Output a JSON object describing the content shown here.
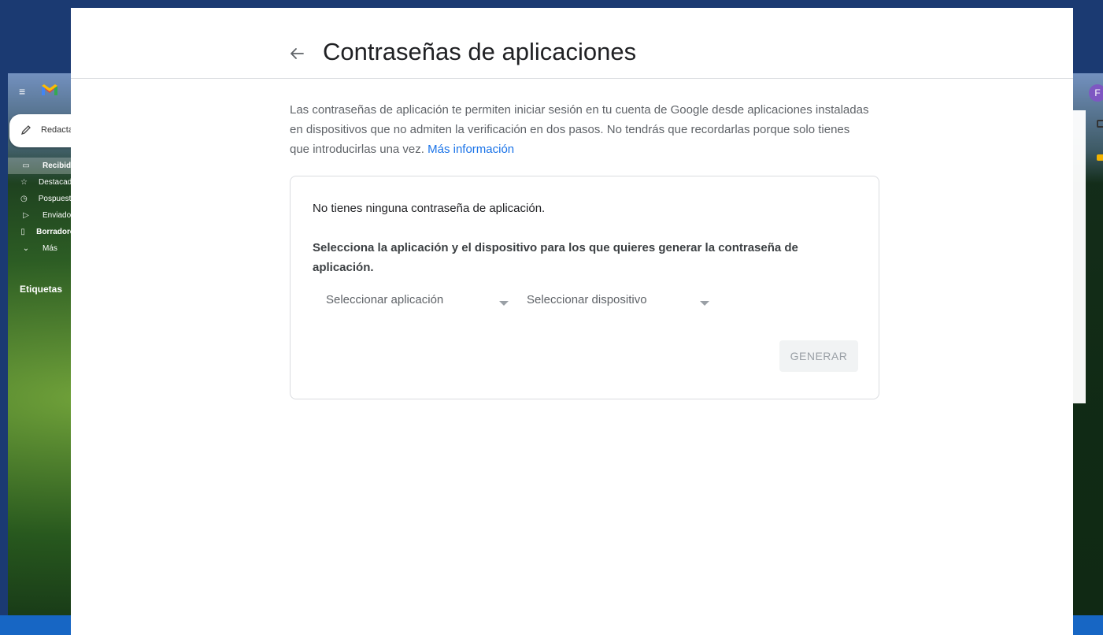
{
  "page": {
    "title": "Contraseñas de aplicaciones",
    "back_icon": "arrow-back-icon"
  },
  "intro": {
    "text": "Las contraseñas de aplicación te permiten iniciar sesión en tu cuenta de Google desde aplicaciones instaladas en dispositivos que no admiten la verificación en dos pasos. No tendrás que recordarlas porque solo tienes que introducirlas una vez.",
    "link_label": "Más información"
  },
  "card": {
    "empty_message": "No tienes ninguna contraseña de aplicación.",
    "prompt": "Selecciona la aplicación y el dispositivo para los que quieres generar la contraseña de aplicación.",
    "app_select": {
      "value": "Seleccionar aplicación"
    },
    "device_select": {
      "value": "Seleccionar dispositivo"
    },
    "generate_label": "GENERAR"
  },
  "background_gmail": {
    "compose_label": "Redacta",
    "nav_items": [
      {
        "label": "Recibido",
        "icon": "inbox-icon"
      },
      {
        "label": "Destacados",
        "icon": "star-icon"
      },
      {
        "label": "Pospuestos",
        "icon": "clock-icon"
      },
      {
        "label": "Enviados",
        "icon": "send-icon"
      },
      {
        "label": "Borradores",
        "icon": "draft-icon"
      },
      {
        "label": "Más",
        "icon": "chevron-down-icon"
      }
    ],
    "labels_heading": "Etiquetas",
    "avatar_letter": "F"
  },
  "colors": {
    "link": "#1a73e8",
    "title_text": "#202124",
    "secondary_text": "#5f6368",
    "button_bg_disabled": "#f1f3f4",
    "button_text_disabled": "#9aa0a6",
    "desktop_bg": "#1b3a72",
    "avatar": "#7e57c2"
  }
}
